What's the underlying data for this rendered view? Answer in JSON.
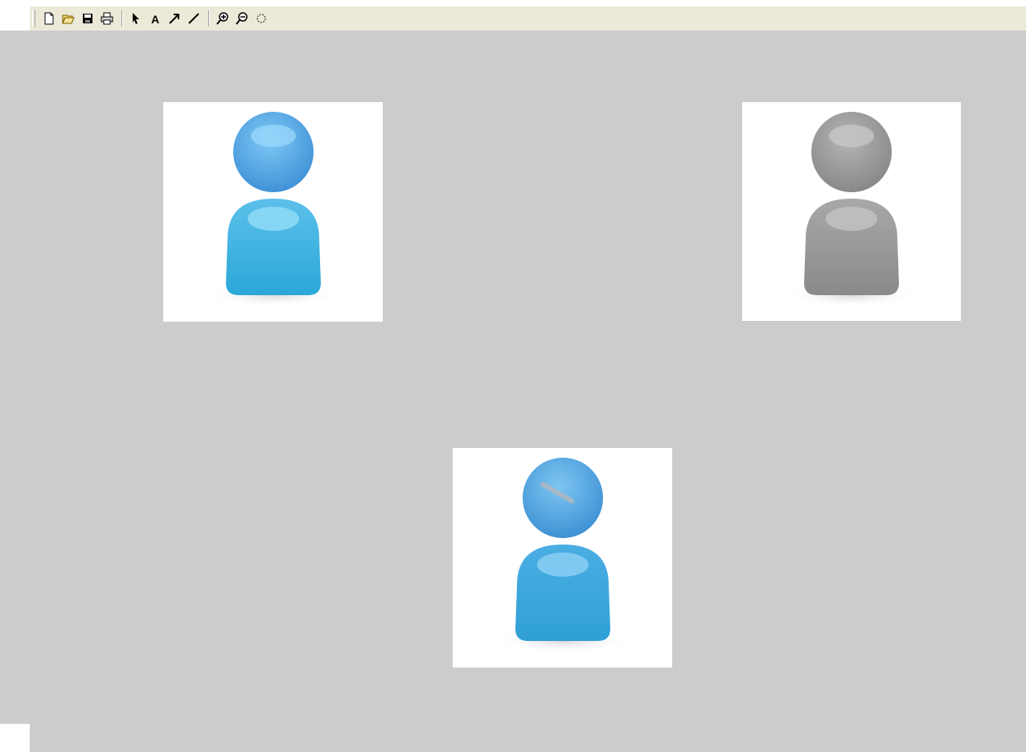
{
  "toolbar": {
    "buttons": [
      {
        "name": "new-document-icon"
      },
      {
        "name": "open-folder-icon"
      },
      {
        "name": "save-icon"
      },
      {
        "name": "print-icon"
      },
      {
        "name": "select-pointer-icon"
      },
      {
        "name": "text-tool-icon",
        "glyph": "A"
      },
      {
        "name": "arrow-tool-icon"
      },
      {
        "name": "line-tool-icon"
      },
      {
        "name": "zoom-in-icon"
      },
      {
        "name": "zoom-out-icon"
      },
      {
        "name": "rotate-icon"
      }
    ]
  },
  "images": [
    {
      "name": "user-icon-blue",
      "color": "blue"
    },
    {
      "name": "user-icon-gray",
      "color": "gray"
    },
    {
      "name": "user-icon-blue-reflected",
      "color": "blue"
    }
  ],
  "colors": {
    "canvas": "#cccccc",
    "toolbar": "#ece9d8",
    "blue_head": "#5aace8",
    "blue_body": "#3fb3dc",
    "gray": "#9a9a9a"
  }
}
